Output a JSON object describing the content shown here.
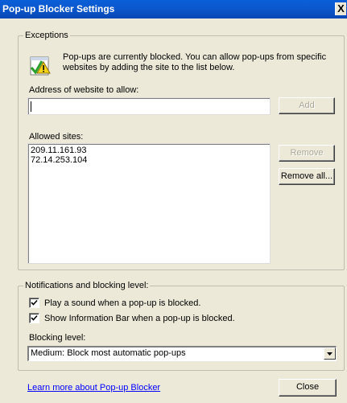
{
  "window": {
    "title": "Pop-up Blocker Settings",
    "close_glyph": "X"
  },
  "exceptions": {
    "legend": "Exceptions",
    "info_text": "Pop-ups are currently blocked.  You can allow pop-ups from specific websites by adding the site to the list below.",
    "info_icon": "shield-warning-icon",
    "address_label": "Address of website to allow:",
    "address_value": "",
    "add_label": "Add",
    "allowed_label": "Allowed sites:",
    "allowed_sites": [
      "209.11.161.93",
      "72.14.253.104"
    ],
    "remove_label": "Remove",
    "remove_all_label": "Remove all..."
  },
  "notifications": {
    "legend": "Notifications and blocking level:",
    "play_sound_label": "Play a sound when a pop-up is blocked.",
    "play_sound_checked": true,
    "info_bar_label": "Show Information Bar when a pop-up is blocked.",
    "info_bar_checked": true,
    "blocking_level_label": "Blocking level:",
    "blocking_level_value": "Medium: Block most automatic pop-ups"
  },
  "footer": {
    "learn_more_link": "Learn more about Pop-up Blocker",
    "close_label": "Close"
  },
  "colors": {
    "titlebar": "#0a5fd8",
    "dialog_bg": "#ece9d8",
    "link": "#0000ff"
  }
}
